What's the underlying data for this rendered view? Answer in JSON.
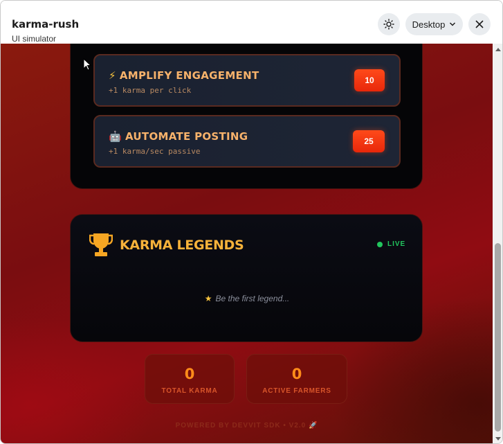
{
  "window": {
    "title": "karma-rush",
    "subtitle": "UI simulator",
    "device_label": "Desktop"
  },
  "upgrades": [
    {
      "icon": "⚡",
      "name": "AMPLIFY ENGAGEMENT",
      "description": "+1 karma per click",
      "cost": "10"
    },
    {
      "icon": "🤖",
      "name": "AUTOMATE POSTING",
      "description": "+1 karma/sec passive",
      "cost": "25"
    }
  ],
  "leaderboard": {
    "title": "KARMA LEGENDS",
    "live_label": "LIVE",
    "empty_message": "Be the first legend..."
  },
  "stats": {
    "total_karma": {
      "value": "0",
      "label": "TOTAL KARMA"
    },
    "active_farmers": {
      "value": "0",
      "label": "ACTIVE FARMERS"
    }
  },
  "footer": {
    "text": "POWERED BY DEVVIT SDK • V2.0 🚀"
  },
  "colors": {
    "accent_orange": "#f7b23a",
    "cost_badge": "#ff4a1a",
    "live_green": "#22c55e",
    "background_red": "#7a0d10"
  }
}
